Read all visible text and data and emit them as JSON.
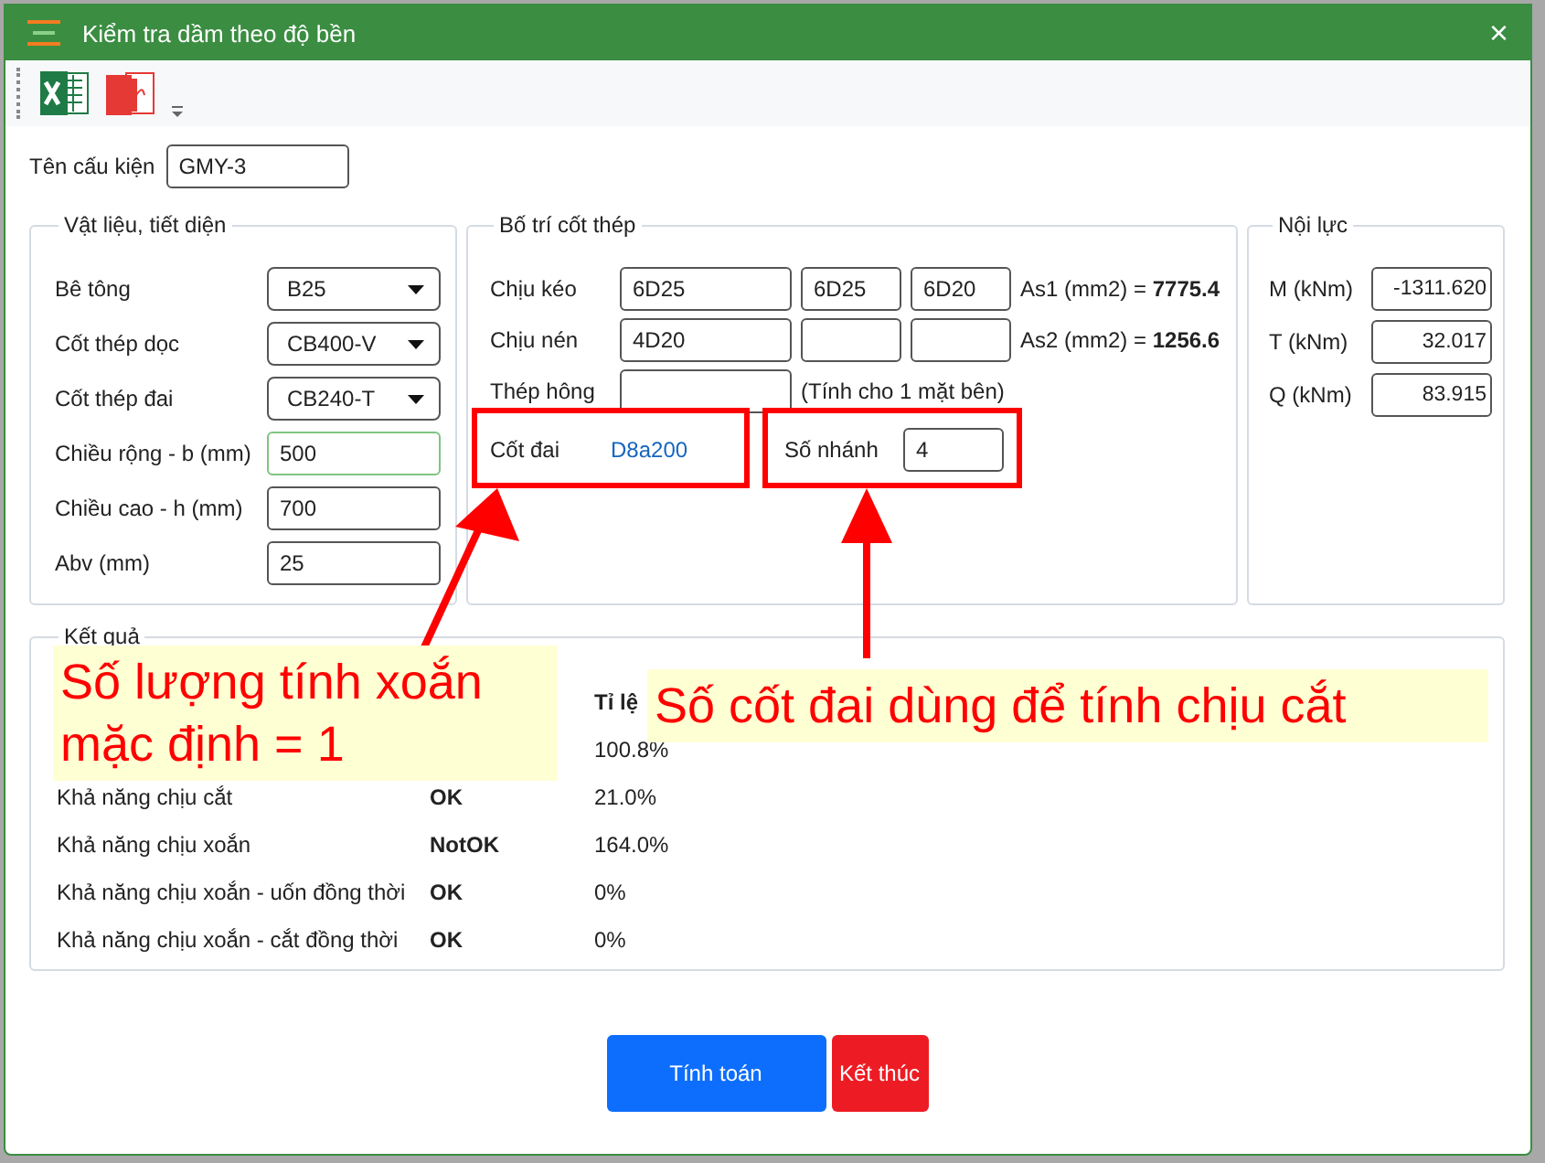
{
  "window": {
    "title": "Kiểm tra dầm theo độ bền",
    "close": "×"
  },
  "component": {
    "label": "Tên cấu kiện",
    "value": "GMY-3"
  },
  "materials": {
    "title": "Vật liệu, tiết diện",
    "rows": [
      {
        "label": "Bê tông",
        "kind": "select",
        "value": "B25",
        "focused": false
      },
      {
        "label": "Cốt thép dọc",
        "kind": "select",
        "value": "CB400-V",
        "focused": false
      },
      {
        "label": "Cốt thép đai",
        "kind": "select",
        "value": "CB240-T",
        "focused": false
      },
      {
        "label": "Chiều rộng - b (mm)",
        "kind": "input",
        "value": "500",
        "focused": true
      },
      {
        "label": "Chiều cao - h (mm)",
        "kind": "input",
        "value": "700",
        "focused": false
      },
      {
        "label": "Abv (mm)",
        "kind": "input",
        "value": "25",
        "focused": false
      }
    ]
  },
  "rebar": {
    "title": "Bố trí cốt thép",
    "bars": [
      {
        "label": "Chịu kéo",
        "values": [
          "6D25",
          "6D25",
          "6D20"
        ],
        "area_label": "As1 (mm2) =",
        "area_value": "7775.4"
      },
      {
        "label": "Chịu nén",
        "values": [
          "4D20"
        ],
        "area_label": "As2 (mm2) =",
        "area_value": "1256.6"
      }
    ],
    "side": {
      "label": "Thép hông",
      "note": "(Tính cho 1 mặt bên)"
    },
    "stirrup": {
      "label": "Cốt đai",
      "value": "D8a200"
    },
    "branches": {
      "label": "Số nhánh",
      "value": "4"
    }
  },
  "forces": {
    "title": "Nội lực",
    "rows": [
      {
        "label": "M (kNm)",
        "value": "-1311.620"
      },
      {
        "label": "T (kNm)",
        "value": "32.017"
      },
      {
        "label": "Q (kNm)",
        "value": "83.915"
      }
    ]
  },
  "results": {
    "title": "Kết quả",
    "header": {
      "ratio": "Tỉ lệ"
    },
    "rows": [
      {
        "ratio": "100.8%"
      },
      {
        "condition": "Khả năng chịu cắt",
        "result": "OK",
        "ratio": "21.0%"
      },
      {
        "condition": "Khả năng chịu xoắn",
        "result": "NotOK",
        "ratio": "164.0%"
      },
      {
        "condition": "Khả năng chịu xoắn - uốn đồng thời",
        "result": "OK",
        "ratio": "0%"
      },
      {
        "condition": "Khả năng chịu xoắn - cắt đồng thời",
        "result": "OK",
        "ratio": "0%"
      }
    ]
  },
  "buttons": [
    {
      "label": "Tính toán",
      "kind": "primary"
    },
    {
      "label": "Kết thúc",
      "kind": "danger"
    }
  ],
  "annotations": [
    {
      "kind": "callout",
      "text": "Số lượng tính xoắn mặc định = 1"
    },
    {
      "kind": "callout",
      "text": "Số cốt đai dùng để tính chịu cắt"
    }
  ]
}
